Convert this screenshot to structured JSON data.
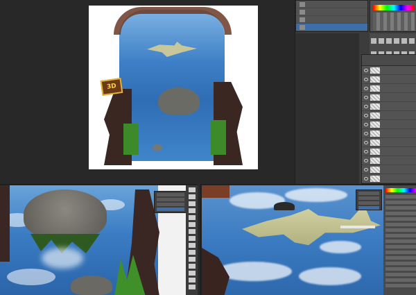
{
  "history_panel": {
    "rows": [
      "",
      "",
      "",
      ""
    ],
    "selected_index": 3
  },
  "logo": {
    "text": "3D"
  },
  "layers_panel": {
    "rows": [
      "",
      "",
      "",
      "",
      "",
      "",
      "",
      "",
      "",
      "",
      "",
      "",
      ""
    ]
  },
  "colors": {
    "workspace": "#282828",
    "panel": "#535353",
    "selection": "#3d6ea8",
    "brick": "#6b3a26"
  },
  "icons": [
    "eye-icon",
    "layer-thumbnail-icon",
    "tool-icon",
    "color-spectrum"
  ]
}
